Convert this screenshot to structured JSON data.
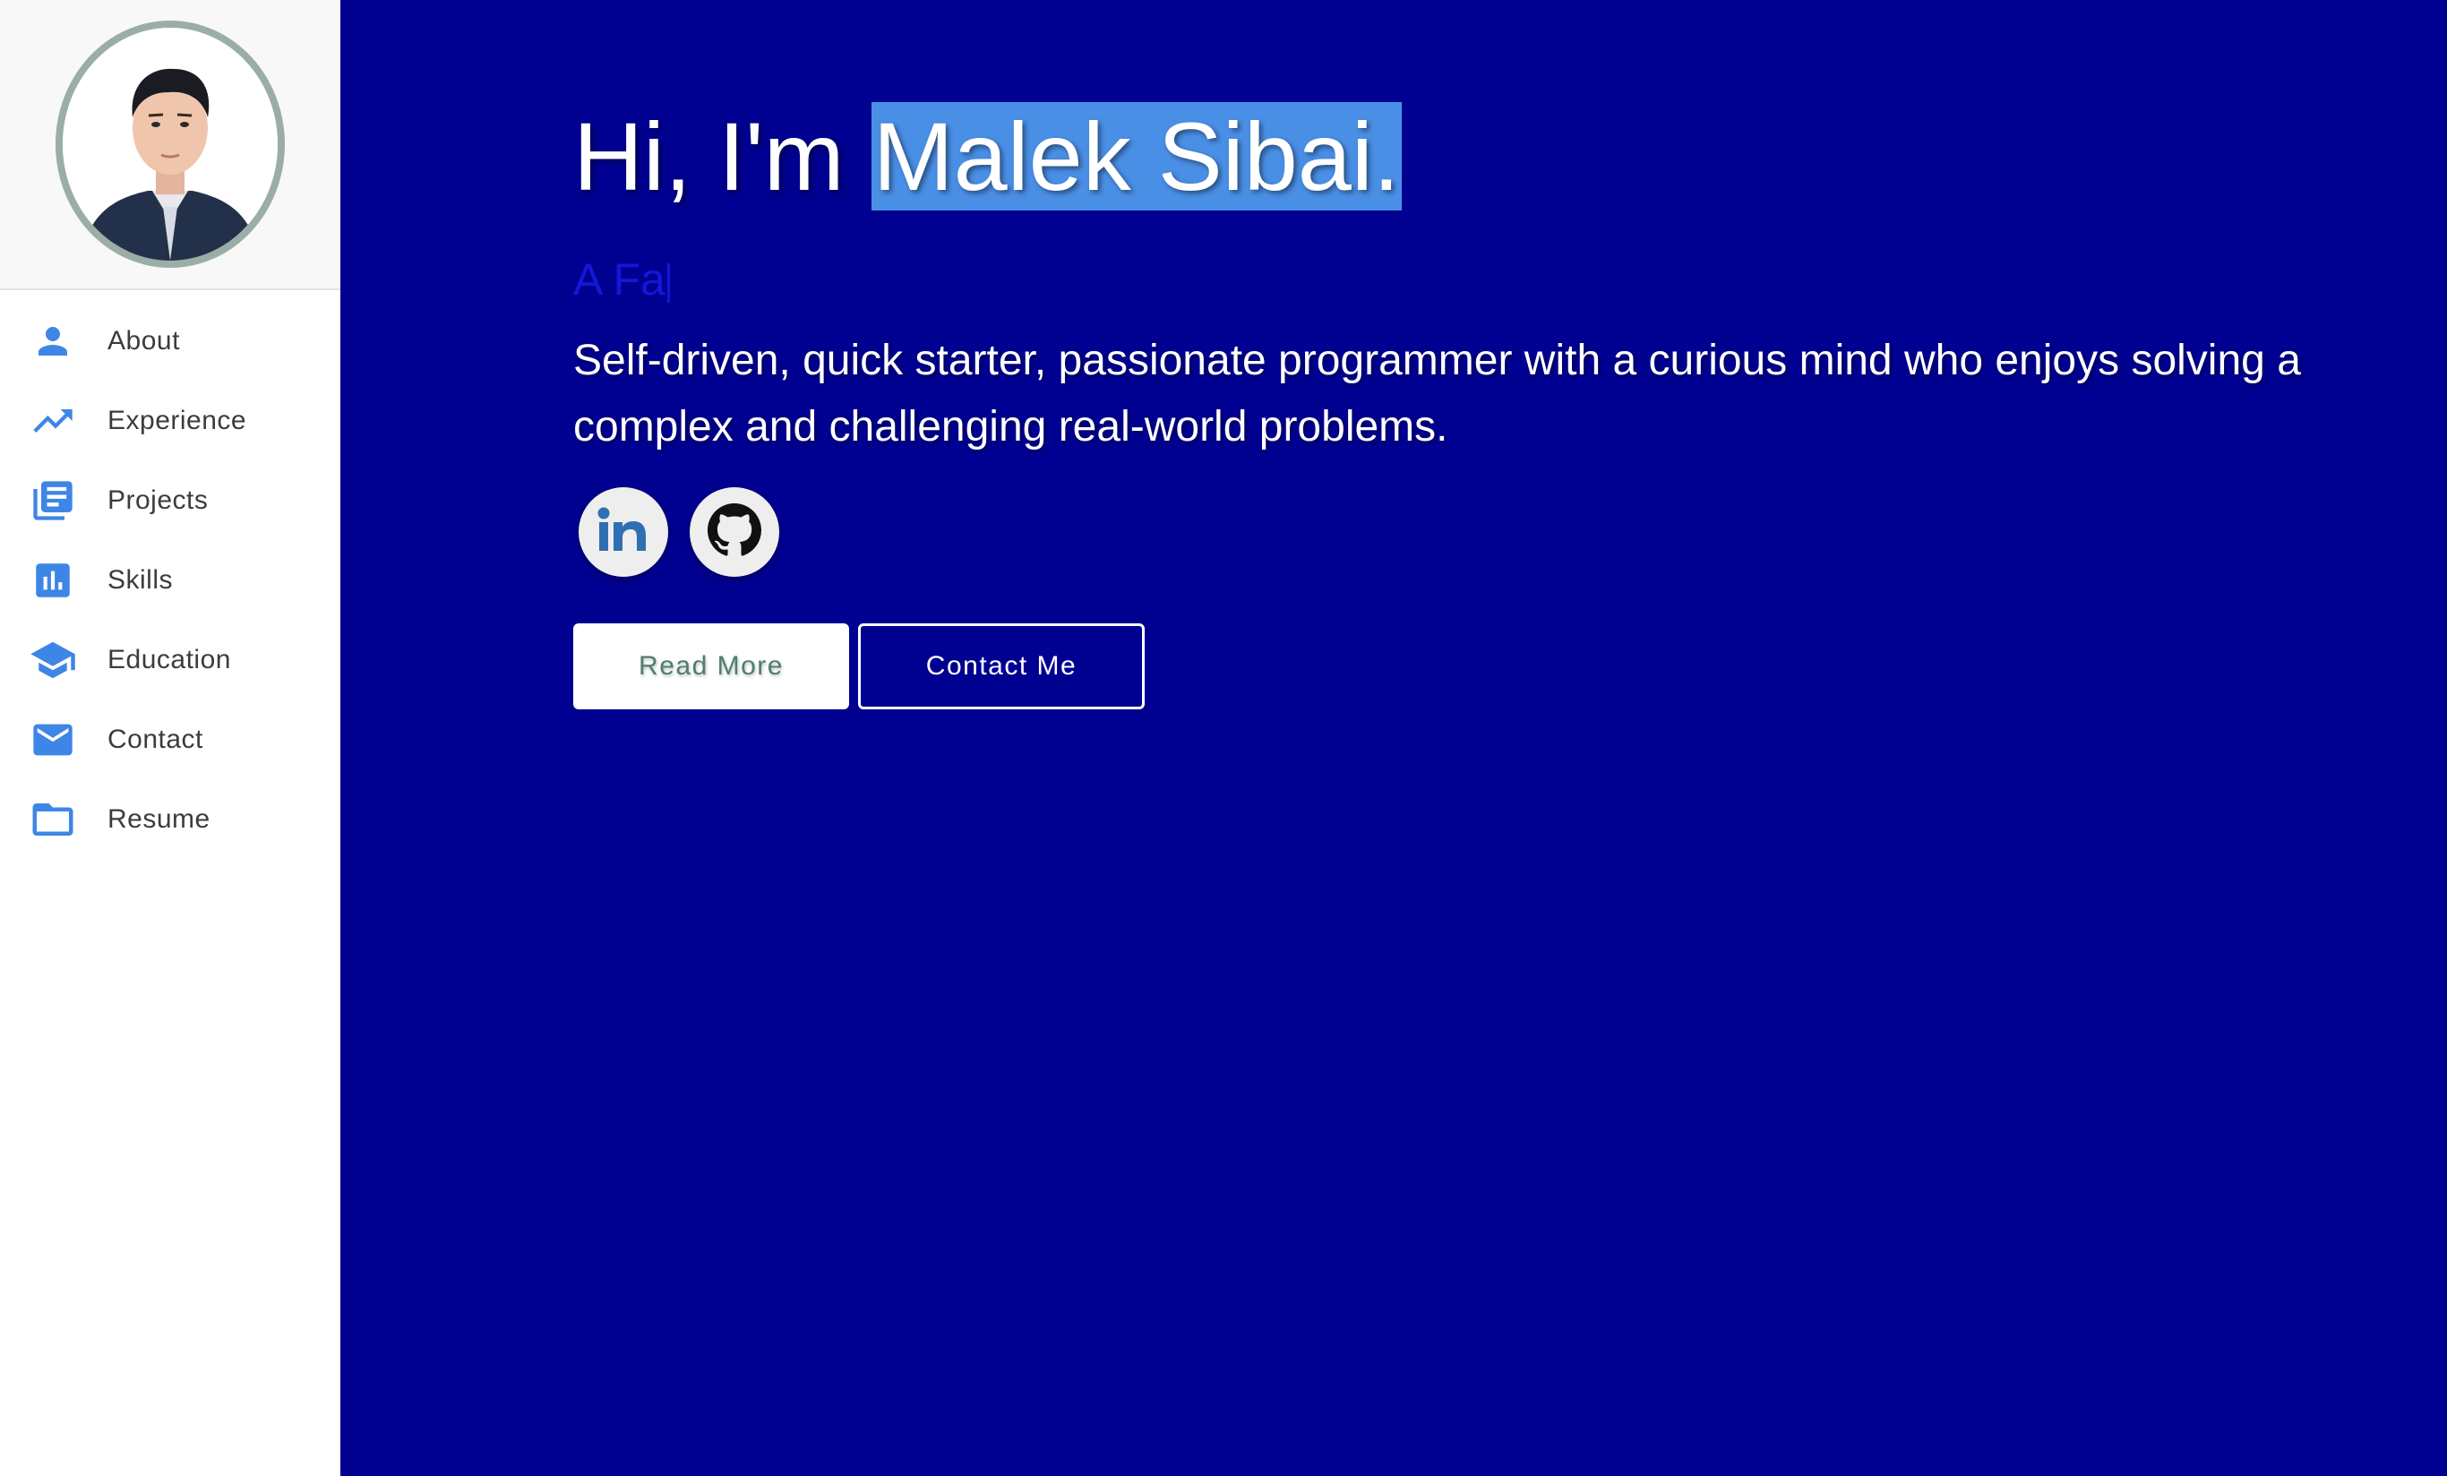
{
  "sidebar": {
    "items": [
      {
        "label": "About",
        "icon": "person-icon"
      },
      {
        "label": "Experience",
        "icon": "trending-up-icon"
      },
      {
        "label": "Projects",
        "icon": "library-books-icon"
      },
      {
        "label": "Skills",
        "icon": "bar-chart-icon"
      },
      {
        "label": "Education",
        "icon": "graduation-cap-icon"
      },
      {
        "label": "Contact",
        "icon": "mail-icon"
      },
      {
        "label": "Resume",
        "icon": "folder-icon"
      }
    ]
  },
  "hero": {
    "greeting": "Hi, I'm ",
    "name": "Malek Sibai.",
    "typed_text": "A Fa",
    "bio": "Self-driven, quick starter, passionate programmer with a curious mind who enjoys solving a complex and challenging real-world problems.",
    "socials": [
      {
        "icon": "linkedin-icon"
      },
      {
        "icon": "github-icon"
      }
    ],
    "read_more_label": "Read More",
    "contact_label": "Contact Me"
  },
  "colors": {
    "main_background": "#000091",
    "accent": "#3e86e6",
    "highlight": "#4a8fe6"
  }
}
